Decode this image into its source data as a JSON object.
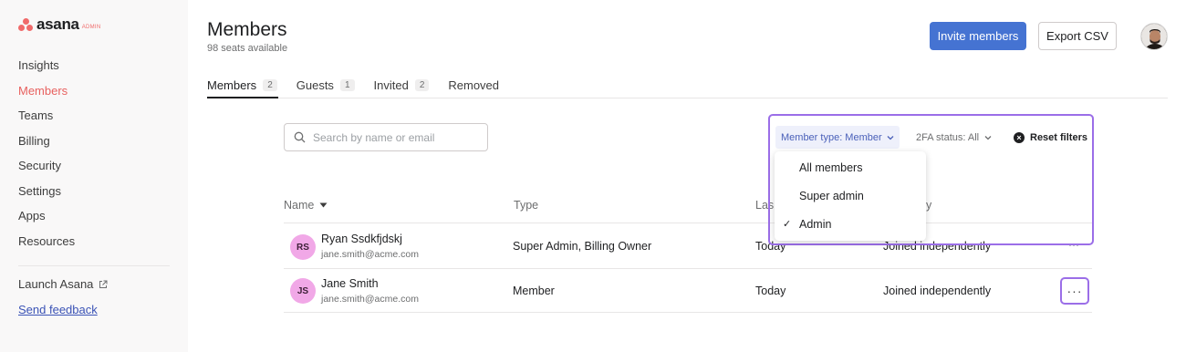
{
  "brand": {
    "name": "asana",
    "badge": "ADMIN",
    "accent": "#f06a6a"
  },
  "sidebar": {
    "items": [
      {
        "label": "Insights"
      },
      {
        "label": "Members",
        "active": true
      },
      {
        "label": "Teams"
      },
      {
        "label": "Billing"
      },
      {
        "label": "Security"
      },
      {
        "label": "Settings"
      },
      {
        "label": "Apps"
      },
      {
        "label": "Resources"
      }
    ],
    "launch": "Launch Asana",
    "feedback": "Send feedback"
  },
  "header": {
    "title": "Members",
    "subtitle": "98 seats available",
    "invite": "Invite members",
    "export": "Export CSV"
  },
  "tabs": [
    {
      "label": "Members",
      "count": "2",
      "active": true
    },
    {
      "label": "Guests",
      "count": "1"
    },
    {
      "label": "Invited",
      "count": "2"
    },
    {
      "label": "Removed",
      "count": ""
    }
  ],
  "search": {
    "placeholder": "Search by name or email",
    "value": ""
  },
  "filters": {
    "member_type": "Member type: Member",
    "twofa": "2FA status: All",
    "reset": "Reset filters"
  },
  "dropdown": {
    "options": [
      {
        "label": "All members",
        "checked": false
      },
      {
        "label": "Super admin",
        "checked": false
      },
      {
        "label": "Admin",
        "checked": true
      }
    ]
  },
  "table": {
    "columns": {
      "name": "Name",
      "type": "Type",
      "last_partial": "Las",
      "third_partial": "y"
    },
    "rows": [
      {
        "initials": "RS",
        "name": "Ryan Ssdkfjdskj",
        "email": "jane.smith@acme.com",
        "type": "Super Admin, Billing Owner",
        "last": "Today",
        "joined": "Joined independently"
      },
      {
        "initials": "JS",
        "name": "Jane Smith",
        "email": "jane.smith@acme.com",
        "type": "Member",
        "last": "Today",
        "joined": "Joined independently"
      }
    ]
  },
  "colors": {
    "primary": "#4573d2",
    "highlight": "#9b6ee8",
    "avatar": "#f1a8e7",
    "active_nav": "#e8615f"
  }
}
